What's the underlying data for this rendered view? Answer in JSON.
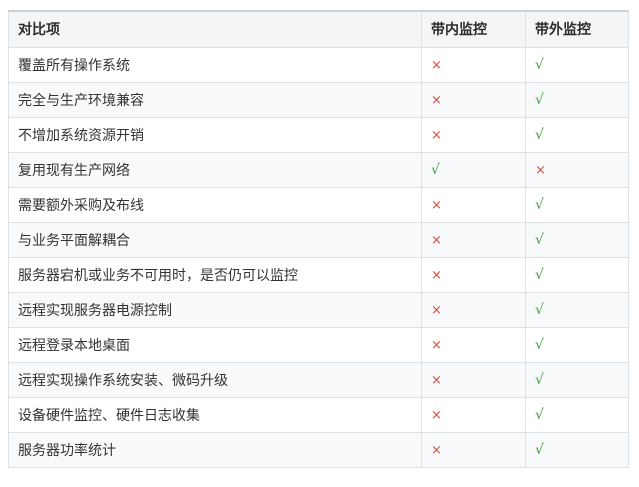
{
  "table": {
    "headers": [
      "对比项",
      "带内监控",
      "带外监控"
    ],
    "rows": [
      {
        "item": "覆盖所有操作系统",
        "in_band": "×",
        "out_band": "√"
      },
      {
        "item": "完全与生产环境兼容",
        "in_band": "×",
        "out_band": "√"
      },
      {
        "item": "不增加系统资源开销",
        "in_band": "×",
        "out_band": "√"
      },
      {
        "item": "复用现有生产网络",
        "in_band": "√",
        "out_band": "×"
      },
      {
        "item": "需要额外采购及布线",
        "in_band": "×",
        "out_band": "√"
      },
      {
        "item": "与业务平面解耦合",
        "in_band": "×",
        "out_band": "√"
      },
      {
        "item": "服务器宕机或业务不可用时，是否仍可以监控",
        "in_band": "×",
        "out_band": "√"
      },
      {
        "item": "远程实现服务器电源控制",
        "in_band": "×",
        "out_band": "√"
      },
      {
        "item": "远程登录本地桌面",
        "in_band": "×",
        "out_band": "√"
      },
      {
        "item": "远程实现操作系统安装、微码升级",
        "in_band": "×",
        "out_band": "√"
      },
      {
        "item": "设备硬件监控、硬件日志收集",
        "in_band": "×",
        "out_band": "√"
      },
      {
        "item": "服务器功率统计",
        "in_band": "×",
        "out_band": "√"
      }
    ]
  },
  "colors": {
    "cross": "#e2483d",
    "check": "#3e9d3a",
    "header_bg": "#f3f5f7",
    "border": "#dfe2e5"
  }
}
